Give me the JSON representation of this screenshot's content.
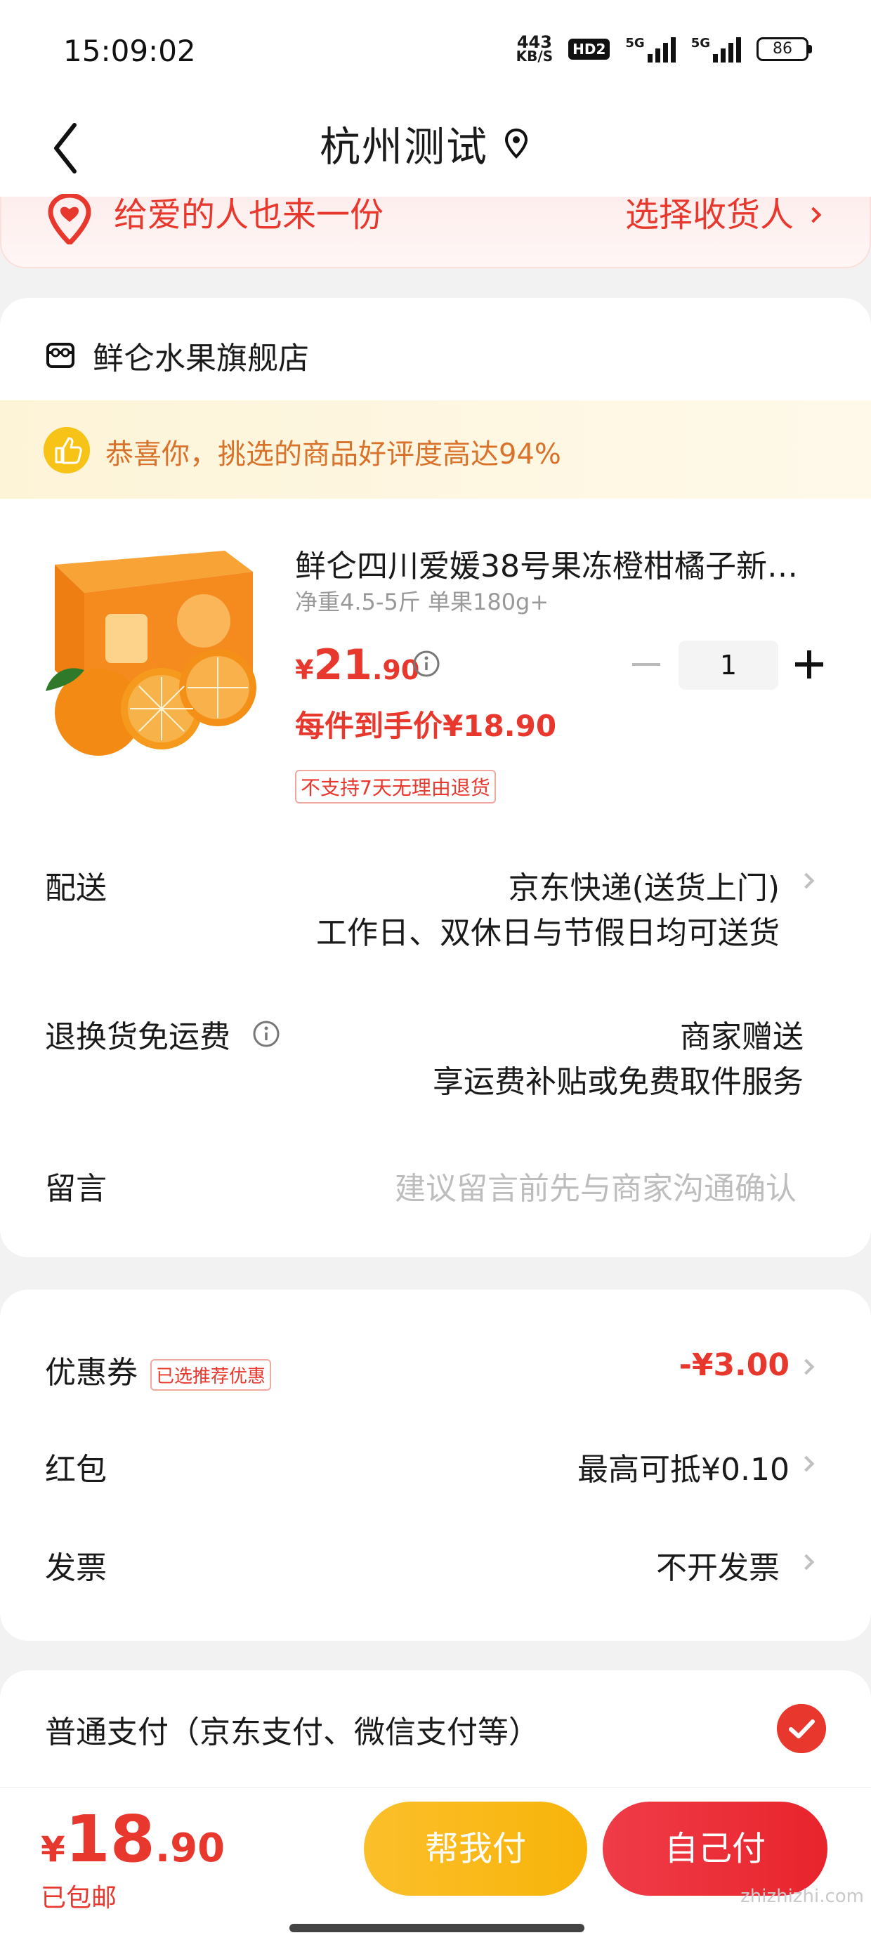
{
  "status_bar": {
    "time": "15:09:02",
    "net_speed_value": "443",
    "net_speed_unit": "KB/S",
    "hd_label": "HD2",
    "sim1_label": "5G",
    "sim2_label": "5G",
    "battery": "86"
  },
  "header": {
    "title": "杭州测试"
  },
  "gift_banner": {
    "text": "给爱的人也来一份",
    "action": "选择收货人"
  },
  "store": {
    "name": "鲜仑水果旗舰店"
  },
  "praise": {
    "text": "恭喜你，挑选的商品好评度高达94%"
  },
  "product": {
    "title": "鲜仑四川爱媛38号果冻橙柑橘子新…",
    "spec": "净重4.5-5斤 单果180g+",
    "price_currency": "¥",
    "price_int": "21",
    "price_dec": ".90",
    "quantity": "1",
    "unit_price": "每件到手价¥18.90",
    "no_return": "不支持7天无理由退货"
  },
  "delivery": {
    "label": "配送",
    "value": "京东快递(送货上门)",
    "sub": "工作日、双休日与节假日均可送货"
  },
  "return_shipping": {
    "label": "退换货免运费",
    "value": "商家赠送",
    "sub": "享运费补贴或免费取件服务"
  },
  "message": {
    "label": "留言",
    "placeholder": "建议留言前先与商家沟通确认"
  },
  "coupon": {
    "label": "优惠券",
    "tag": "已选推荐优惠",
    "value": "-¥3.00"
  },
  "red_packet": {
    "label": "红包",
    "value": "最高可抵¥0.10"
  },
  "invoice": {
    "label": "发票",
    "value": "不开发票"
  },
  "payment": {
    "label": "普通支付（京东支付、微信支付等）"
  },
  "bottom_bar": {
    "currency": "¥",
    "total_int": "18",
    "total_dec": ".90",
    "shipping": "已包邮",
    "help_pay": "帮我付",
    "self_pay": "自己付"
  },
  "watermark": {
    "text": "zhizhizhi.com"
  },
  "colors": {
    "accent_red": "#e8382e",
    "praise_orange": "#d9722a",
    "help_button": "#f8b40a",
    "self_button": "#e8242c"
  },
  "icons": {
    "back": "chevron-left-icon",
    "location": "location-pin-icon",
    "store": "store-icon",
    "thumb": "thumbs-up-icon",
    "info": "info-icon",
    "check": "check-circle-icon"
  }
}
